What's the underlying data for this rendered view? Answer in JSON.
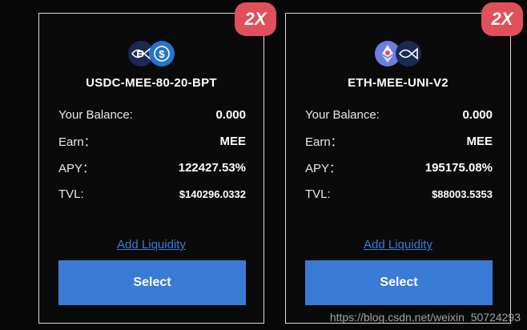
{
  "cards": [
    {
      "multiplier": "2X",
      "pair_name": "USDC-MEE-80-20-BPT",
      "balance_label": "Your Balance:",
      "balance_value": "0.000",
      "earn_label": "Earn：",
      "earn_value": "MEE",
      "apy_label": "APY：",
      "apy_value": "122427.53%",
      "tvl_label": "TVL:",
      "tvl_value": "$140296.0332",
      "add_liquidity": "Add Liquidity",
      "select": "Select",
      "icons": [
        "mee-fish-icon",
        "usdc-icon"
      ]
    },
    {
      "multiplier": "2X",
      "pair_name": "ETH-MEE-UNI-V2",
      "balance_label": "Your Balance:",
      "balance_value": "0.000",
      "earn_label": "Earn：",
      "earn_value": "MEE",
      "apy_label": "APY：",
      "apy_value": "195175.08%",
      "tvl_label": "TVL:",
      "tvl_value": "$88003.5353",
      "add_liquidity": "Add Liquidity",
      "select": "Select",
      "icons": [
        "eth-icon",
        "mee-fish-icon"
      ]
    }
  ],
  "watermark": "https://blog.csdn.net/weixin_50724293",
  "colors": {
    "accent": "#3a7bd5",
    "badge": "#e0505b",
    "background": "#080808"
  }
}
